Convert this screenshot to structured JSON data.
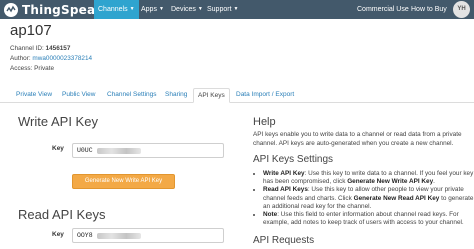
{
  "nav": {
    "brand": "ThingSpeak",
    "items": [
      {
        "label": "Channels",
        "active": true,
        "caret": true
      },
      {
        "label": "Apps",
        "caret": true
      },
      {
        "label": "Devices",
        "caret": true
      },
      {
        "label": "Support",
        "caret": true
      }
    ],
    "right_items": [
      "Commercial Use",
      "How to Buy"
    ],
    "avatar_initials": "YH",
    "colors": {
      "bar": "#43596b",
      "active": "#2fa4cf"
    }
  },
  "channel": {
    "title": "ap107",
    "id_label": "Channel ID:",
    "id_value": "1456157",
    "author_label": "Author:",
    "author_value": "mwa0000023378214",
    "access_label": "Access:",
    "access_value": "Private"
  },
  "tabs": [
    {
      "label": "Private View"
    },
    {
      "label": "Public View"
    },
    {
      "label": "Channel Settings"
    },
    {
      "label": "Sharing"
    },
    {
      "label": "API Keys",
      "active": true
    },
    {
      "label": "Data Import / Export"
    }
  ],
  "write": {
    "heading": "Write API Key",
    "key_label": "Key",
    "key_value": "U0UC",
    "button_label": "Generate New Write API Key",
    "button_color": "#f3a946"
  },
  "read": {
    "heading": "Read API Keys",
    "key_label": "Key",
    "key_value": "OOY8"
  },
  "help": {
    "heading": "Help",
    "intro": "API keys enable you to write data to a channel or read data from a private channel. API keys are auto-generated when you create a new channel.",
    "settings_heading": "API Keys Settings",
    "bullets": [
      {
        "term": "Write API Key",
        "text": ": Use this key to write data to a channel. If you feel your key has been compromised, click ",
        "action": "Generate New Write API Key",
        "after": "."
      },
      {
        "term": "Read API Keys",
        "text": ": Use this key to allow other people to view your private channel feeds and charts. Click ",
        "action": "Generate New Read API Key",
        "after": " to generate an additional read key for the channel."
      },
      {
        "term": "Note",
        "text": ": Use this field to enter information about channel read keys. For example, add notes to keep track of users with access to your channel.",
        "action": "",
        "after": ""
      }
    ],
    "requests_heading": "API Requests"
  }
}
